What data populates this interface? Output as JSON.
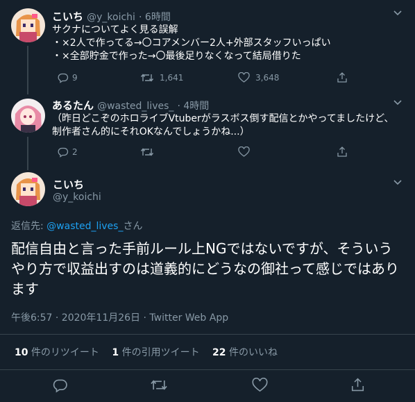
{
  "tweets": [
    {
      "name": "こいち",
      "handle": "@y_koichi",
      "time": "· 6時間",
      "text": "サクナについてよく見る誤解\n・×2人で作ってる→〇コアメンバー2人+外部スタッフいっぱい\n・×全部貯金で作った→〇最後足りなくなって結局借りた",
      "replies": "9",
      "retweets": "1,641",
      "likes": "3,648"
    },
    {
      "name": "あるたん",
      "handle": "@wasted_lives_",
      "time": "· 4時間",
      "text": "（昨日どこぞのホロライブVtuberがラスボス倒す配信とかやってましたけど、制作者さん的にそれOKなんでしょうかね...）",
      "replies": "2",
      "retweets": "",
      "likes": ""
    }
  ],
  "main": {
    "name": "こいち",
    "handle": "@y_koichi",
    "reply_to_prefix": "返信先: ",
    "reply_to_handle": "@wasted_lives_",
    "reply_to_suffix": "さん",
    "text": "配信自由と言った手前ルール上NGではないですが、そういうやり方で収益出すのは道義的にどうなの御社って感じではあります",
    "timestamp": "午後6:57 · 2020年11月26日 · Twitter Web App",
    "retweet_count": "10",
    "retweet_label": " 件のリツイート",
    "quote_count": "1",
    "quote_label": " 件の引用ツイート",
    "like_count": "22",
    "like_label": " 件のいいね"
  },
  "colors": {
    "background": "#15202b",
    "secondary_text": "#8899a6",
    "link": "#1da1f2",
    "divider": "#38444d"
  },
  "icons": [
    "chevron-down-icon",
    "reply-icon",
    "retweet-icon",
    "like-icon",
    "share-icon"
  ]
}
